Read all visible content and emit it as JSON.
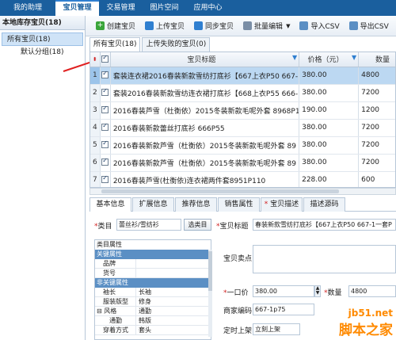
{
  "topnav": {
    "tabs": [
      {
        "label": "我的助理"
      },
      {
        "label": "宝贝管理"
      },
      {
        "label": "交易管理"
      },
      {
        "label": "图片空间"
      },
      {
        "label": "应用中心"
      }
    ]
  },
  "sidebar": {
    "header": "本地库存宝贝(18)",
    "root": "所有宝贝(18)",
    "child": "默认分组(18)"
  },
  "toolbar": {
    "create_label": "创建宝贝",
    "upload_label": "上传宝贝",
    "sync_label": "同步宝贝",
    "batch_edit_label": "批量编辑",
    "import_csv_label": "导入CSV",
    "export_label": "导出CSV"
  },
  "subtabs": {
    "all_label": "所有宝贝(18)",
    "failed_label": "上传失败的宝贝(0)"
  },
  "grid": {
    "headers": {
      "title": "宝贝标题",
      "price": "价格（元）",
      "qty": "数量"
    },
    "rows": [
      {
        "num": "1",
        "title": "套装连衣裙2016春装新款雪纺打底衫【667上衣P50 667-",
        "price": "380.00",
        "qty": "4800"
      },
      {
        "num": "2",
        "title": "套装2016春装新款雪纺连衣裙打底衫【668上衣P55 666-1—",
        "price": "380.00",
        "qty": "7200"
      },
      {
        "num": "3",
        "title": "2016春装芦雪（杜衡依）2015冬装新款毛呢外套 8968P1",
        "price": "190.00",
        "qty": "1200"
      },
      {
        "num": "4",
        "title": "2016春装新款蕾丝打底衫 666P55",
        "price": "380.00",
        "qty": "7200"
      },
      {
        "num": "5",
        "title": "2016春装新款芦雪（杜衡依）2015冬装新款毛呢外套 89",
        "price": "380.00",
        "qty": "7200"
      },
      {
        "num": "6",
        "title": "2016春装新款芦雪（杜衡依）2015冬装新款毛呢外套 89",
        "price": "380.00",
        "qty": "7200"
      },
      {
        "num": "7",
        "title": "2016春装芦雪(杜衡依)连衣裙两件套8951P110",
        "price": "228.00",
        "qty": "600"
      }
    ]
  },
  "bottom_tabs": [
    {
      "label": "基本信息"
    },
    {
      "label": "扩展信息"
    },
    {
      "label": "推荐信息"
    },
    {
      "label": "销售属性"
    },
    {
      "label": "宝贝描述"
    },
    {
      "label": "描述源码"
    }
  ],
  "form": {
    "category_label": "类目",
    "category_value": "蕾丝衫/雪纺衫",
    "select_category_button": "选类目",
    "title_label": "宝贝标题",
    "title_value": "春装新款雪纺打底衫【667上衣P50 667-1一套P",
    "attr_caption": "类目属性",
    "key_attr_section": "关键属性",
    "key_attrs": [
      {
        "k": "品牌",
        "v": ""
      },
      {
        "k": "货号",
        "v": ""
      }
    ],
    "nonkey_attr_section": "非关键属性",
    "nonkey_attrs": [
      {
        "k": "袖长",
        "v": "长袖"
      },
      {
        "k": "服装版型",
        "v": "修身"
      },
      {
        "k": "风格",
        "v": "通勤"
      },
      {
        "k": "通勤",
        "v": "韩版"
      },
      {
        "k": "穿着方式",
        "v": "套头"
      }
    ],
    "selling_point_label": "宝贝卖点",
    "price_label": "一口价",
    "price_value": "380.00",
    "qty_label": "数量",
    "qty_value": "4800",
    "merchant_code_label": "商家编码",
    "merchant_code_value": "667-1p75",
    "scheduled_label": "定时上架",
    "scheduled_value": "立刻上架"
  },
  "watermark": {
    "line1": "jb51.net",
    "line2": "脚本之家"
  }
}
